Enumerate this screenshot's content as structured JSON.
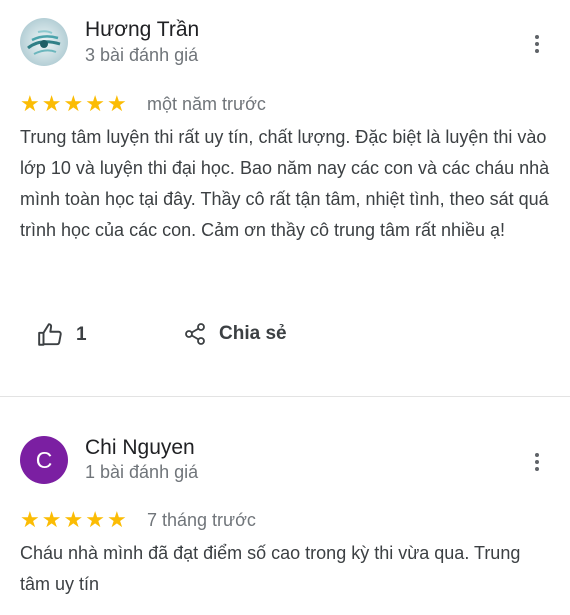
{
  "reviews": [
    {
      "author": "Hương Trần",
      "author_stats": "3 bài đánh giá",
      "rating": 5,
      "time": "một năm trước",
      "text": "Trung tâm luyện thi rất uy tín, chất lượng. Đặc biệt là luyện thi vào lớp 10 và luyện thi đại học. Bao năm nay các con và các cháu nhà mình toàn học tại đây. Thầy cô rất tận tâm, nhiệt tình, theo sát quá trình học của các con. Cảm ơn thầy cô trung tâm rất nhiều ạ!",
      "like_count": "1",
      "share_label": "Chia sẻ",
      "avatar": "photo"
    },
    {
      "author": "Chi Nguyen",
      "author_stats": "1 bài đánh giá",
      "rating": 5,
      "time": "7 tháng trước",
      "text": "Cháu nhà mình đã đạt điểm số cao trong kỳ thi vừa qua. Trung tâm uy tín",
      "avatar_letter": "C",
      "avatar_color": "#7b1fa2"
    }
  ],
  "colors": {
    "star": "#fbbc04",
    "muted": "#70757a"
  },
  "icons": {
    "more": "more-vert-icon",
    "like": "thumb-up-icon",
    "share": "share-icon",
    "star": "star-icon"
  }
}
